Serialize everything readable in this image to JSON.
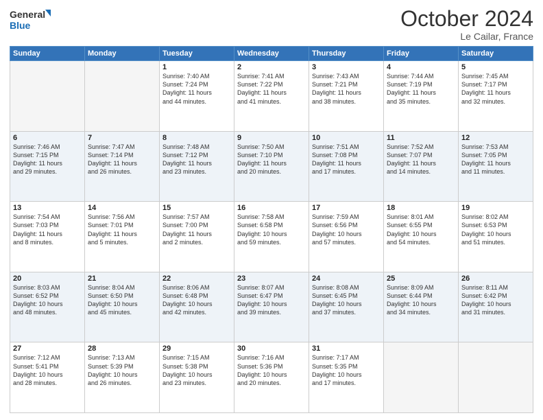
{
  "header": {
    "logo_line1": "General",
    "logo_line2": "Blue",
    "month": "October 2024",
    "location": "Le Cailar, France"
  },
  "days_of_week": [
    "Sunday",
    "Monday",
    "Tuesday",
    "Wednesday",
    "Thursday",
    "Friday",
    "Saturday"
  ],
  "weeks": [
    [
      {
        "day": "",
        "content": ""
      },
      {
        "day": "",
        "content": ""
      },
      {
        "day": "1",
        "content": "Sunrise: 7:40 AM\nSunset: 7:24 PM\nDaylight: 11 hours\nand 44 minutes."
      },
      {
        "day": "2",
        "content": "Sunrise: 7:41 AM\nSunset: 7:22 PM\nDaylight: 11 hours\nand 41 minutes."
      },
      {
        "day": "3",
        "content": "Sunrise: 7:43 AM\nSunset: 7:21 PM\nDaylight: 11 hours\nand 38 minutes."
      },
      {
        "day": "4",
        "content": "Sunrise: 7:44 AM\nSunset: 7:19 PM\nDaylight: 11 hours\nand 35 minutes."
      },
      {
        "day": "5",
        "content": "Sunrise: 7:45 AM\nSunset: 7:17 PM\nDaylight: 11 hours\nand 32 minutes."
      }
    ],
    [
      {
        "day": "6",
        "content": "Sunrise: 7:46 AM\nSunset: 7:15 PM\nDaylight: 11 hours\nand 29 minutes."
      },
      {
        "day": "7",
        "content": "Sunrise: 7:47 AM\nSunset: 7:14 PM\nDaylight: 11 hours\nand 26 minutes."
      },
      {
        "day": "8",
        "content": "Sunrise: 7:48 AM\nSunset: 7:12 PM\nDaylight: 11 hours\nand 23 minutes."
      },
      {
        "day": "9",
        "content": "Sunrise: 7:50 AM\nSunset: 7:10 PM\nDaylight: 11 hours\nand 20 minutes."
      },
      {
        "day": "10",
        "content": "Sunrise: 7:51 AM\nSunset: 7:08 PM\nDaylight: 11 hours\nand 17 minutes."
      },
      {
        "day": "11",
        "content": "Sunrise: 7:52 AM\nSunset: 7:07 PM\nDaylight: 11 hours\nand 14 minutes."
      },
      {
        "day": "12",
        "content": "Sunrise: 7:53 AM\nSunset: 7:05 PM\nDaylight: 11 hours\nand 11 minutes."
      }
    ],
    [
      {
        "day": "13",
        "content": "Sunrise: 7:54 AM\nSunset: 7:03 PM\nDaylight: 11 hours\nand 8 minutes."
      },
      {
        "day": "14",
        "content": "Sunrise: 7:56 AM\nSunset: 7:01 PM\nDaylight: 11 hours\nand 5 minutes."
      },
      {
        "day": "15",
        "content": "Sunrise: 7:57 AM\nSunset: 7:00 PM\nDaylight: 11 hours\nand 2 minutes."
      },
      {
        "day": "16",
        "content": "Sunrise: 7:58 AM\nSunset: 6:58 PM\nDaylight: 10 hours\nand 59 minutes."
      },
      {
        "day": "17",
        "content": "Sunrise: 7:59 AM\nSunset: 6:56 PM\nDaylight: 10 hours\nand 57 minutes."
      },
      {
        "day": "18",
        "content": "Sunrise: 8:01 AM\nSunset: 6:55 PM\nDaylight: 10 hours\nand 54 minutes."
      },
      {
        "day": "19",
        "content": "Sunrise: 8:02 AM\nSunset: 6:53 PM\nDaylight: 10 hours\nand 51 minutes."
      }
    ],
    [
      {
        "day": "20",
        "content": "Sunrise: 8:03 AM\nSunset: 6:52 PM\nDaylight: 10 hours\nand 48 minutes."
      },
      {
        "day": "21",
        "content": "Sunrise: 8:04 AM\nSunset: 6:50 PM\nDaylight: 10 hours\nand 45 minutes."
      },
      {
        "day": "22",
        "content": "Sunrise: 8:06 AM\nSunset: 6:48 PM\nDaylight: 10 hours\nand 42 minutes."
      },
      {
        "day": "23",
        "content": "Sunrise: 8:07 AM\nSunset: 6:47 PM\nDaylight: 10 hours\nand 39 minutes."
      },
      {
        "day": "24",
        "content": "Sunrise: 8:08 AM\nSunset: 6:45 PM\nDaylight: 10 hours\nand 37 minutes."
      },
      {
        "day": "25",
        "content": "Sunrise: 8:09 AM\nSunset: 6:44 PM\nDaylight: 10 hours\nand 34 minutes."
      },
      {
        "day": "26",
        "content": "Sunrise: 8:11 AM\nSunset: 6:42 PM\nDaylight: 10 hours\nand 31 minutes."
      }
    ],
    [
      {
        "day": "27",
        "content": "Sunrise: 7:12 AM\nSunset: 5:41 PM\nDaylight: 10 hours\nand 28 minutes."
      },
      {
        "day": "28",
        "content": "Sunrise: 7:13 AM\nSunset: 5:39 PM\nDaylight: 10 hours\nand 26 minutes."
      },
      {
        "day": "29",
        "content": "Sunrise: 7:15 AM\nSunset: 5:38 PM\nDaylight: 10 hours\nand 23 minutes."
      },
      {
        "day": "30",
        "content": "Sunrise: 7:16 AM\nSunset: 5:36 PM\nDaylight: 10 hours\nand 20 minutes."
      },
      {
        "day": "31",
        "content": "Sunrise: 7:17 AM\nSunset: 5:35 PM\nDaylight: 10 hours\nand 17 minutes."
      },
      {
        "day": "",
        "content": ""
      },
      {
        "day": "",
        "content": ""
      }
    ]
  ]
}
